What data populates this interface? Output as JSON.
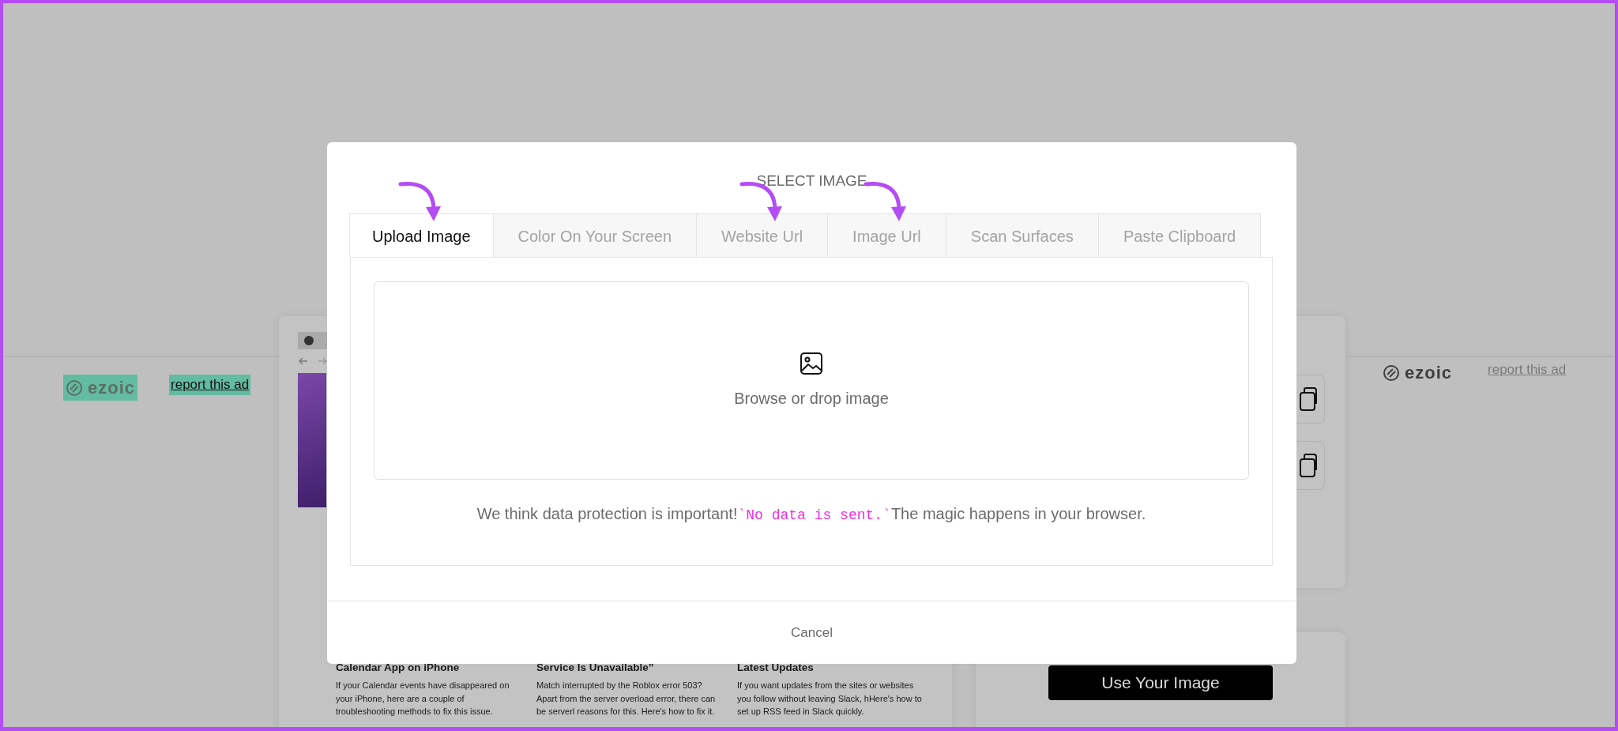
{
  "background": {
    "ads": [
      {
        "logo": "ezoic",
        "report_link": "report this ad",
        "highlighted": true
      },
      {
        "logo": "ezoic",
        "report_link": "report this ad",
        "highlighted": false
      }
    ],
    "articles": [
      {
        "title": "Calendar App on iPhone",
        "summary": "If your Calendar events have disappeared on your iPhone, here are a couple of troubleshooting methods to fix this issue."
      },
      {
        "title": "Service Is Unavailable”",
        "summary": "Match interrupted by the Roblox error 503? Apart from the server overload error, there can be serverl reasons for this. Here's how to fix it."
      },
      {
        "title": "Latest Updates",
        "summary": "If you want updates from the sites or websites you follow without leaving Slack, hHere's how to set up RSS feed in Slack quickly."
      }
    ],
    "copy_buttons": [
      {
        "kind": "copy"
      },
      {
        "kind": "copy"
      }
    ],
    "primary_button": "Use Your Image"
  },
  "modal": {
    "title": "SELECT IMAGE",
    "tabs": [
      {
        "label": "Upload Image",
        "selected": true,
        "arrow": true
      },
      {
        "label": "Color On Your Screen",
        "selected": false,
        "arrow": false
      },
      {
        "label": "Website Url",
        "selected": false,
        "arrow": true
      },
      {
        "label": "Image Url",
        "selected": false,
        "arrow": true
      },
      {
        "label": "Scan Surfaces",
        "selected": false,
        "arrow": false
      },
      {
        "label": "Paste Clipboard",
        "selected": false,
        "arrow": false
      }
    ],
    "dropzone": {
      "text": "Browse or drop image"
    },
    "notice": [
      {
        "kind": "text",
        "text": "We think data protection is important!"
      },
      {
        "kind": "code",
        "text": "`No data is sent.`"
      },
      {
        "kind": "text",
        "text": "The magic happens in your browser."
      }
    ],
    "cancel": "Cancel"
  }
}
